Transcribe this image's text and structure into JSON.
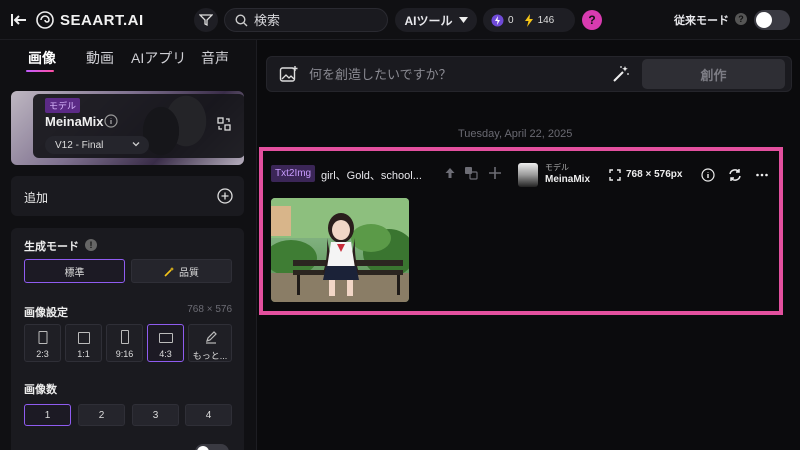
{
  "topbar": {
    "brand": "SEAART.AI",
    "search_placeholder": "検索",
    "ai_tools_label": "AIツール",
    "credit_purple": "0",
    "credit_yellow": "146",
    "help_label": "?",
    "legacy_mode_label": "従来モード",
    "legacy_help": "?"
  },
  "sidebar": {
    "tabs": [
      {
        "label": "画像",
        "active": true
      },
      {
        "label": "動画",
        "active": false
      },
      {
        "label": "AIアプリ",
        "active": false
      },
      {
        "label": "音声",
        "active": false
      }
    ],
    "model": {
      "tag": "モデル",
      "name": "MeinaMix",
      "version": "V12 - Final"
    },
    "add_label": "追加",
    "generation_mode": {
      "title": "生成モード",
      "help": "!",
      "standard": "標準",
      "quality": "品質"
    },
    "image_settings": {
      "title": "画像設定",
      "dimensions": "768 × 576",
      "ratios": [
        "2:3",
        "1:1",
        "9:16",
        "4:3",
        "もっと..."
      ],
      "active_ratio": "4:3"
    },
    "image_count": {
      "title": "画像数",
      "options": [
        "1",
        "2",
        "3",
        "4"
      ],
      "active": "1"
    }
  },
  "main": {
    "prompt_placeholder": "何を創造したいですか？",
    "create_label": "創作",
    "date": "Tuesday, April 22, 2025",
    "result": {
      "badge": "Txt2Img",
      "prompt": "girl、Gold、school...",
      "model_sub": "モデル",
      "model_name": "MeinaMix",
      "size": "768 × 576px"
    }
  },
  "colors": {
    "accent_purple": "#8f5cf0",
    "highlight_pink": "#e3509e",
    "help_pink": "#d83bb0",
    "bolt_yellow": "#f5c518"
  }
}
